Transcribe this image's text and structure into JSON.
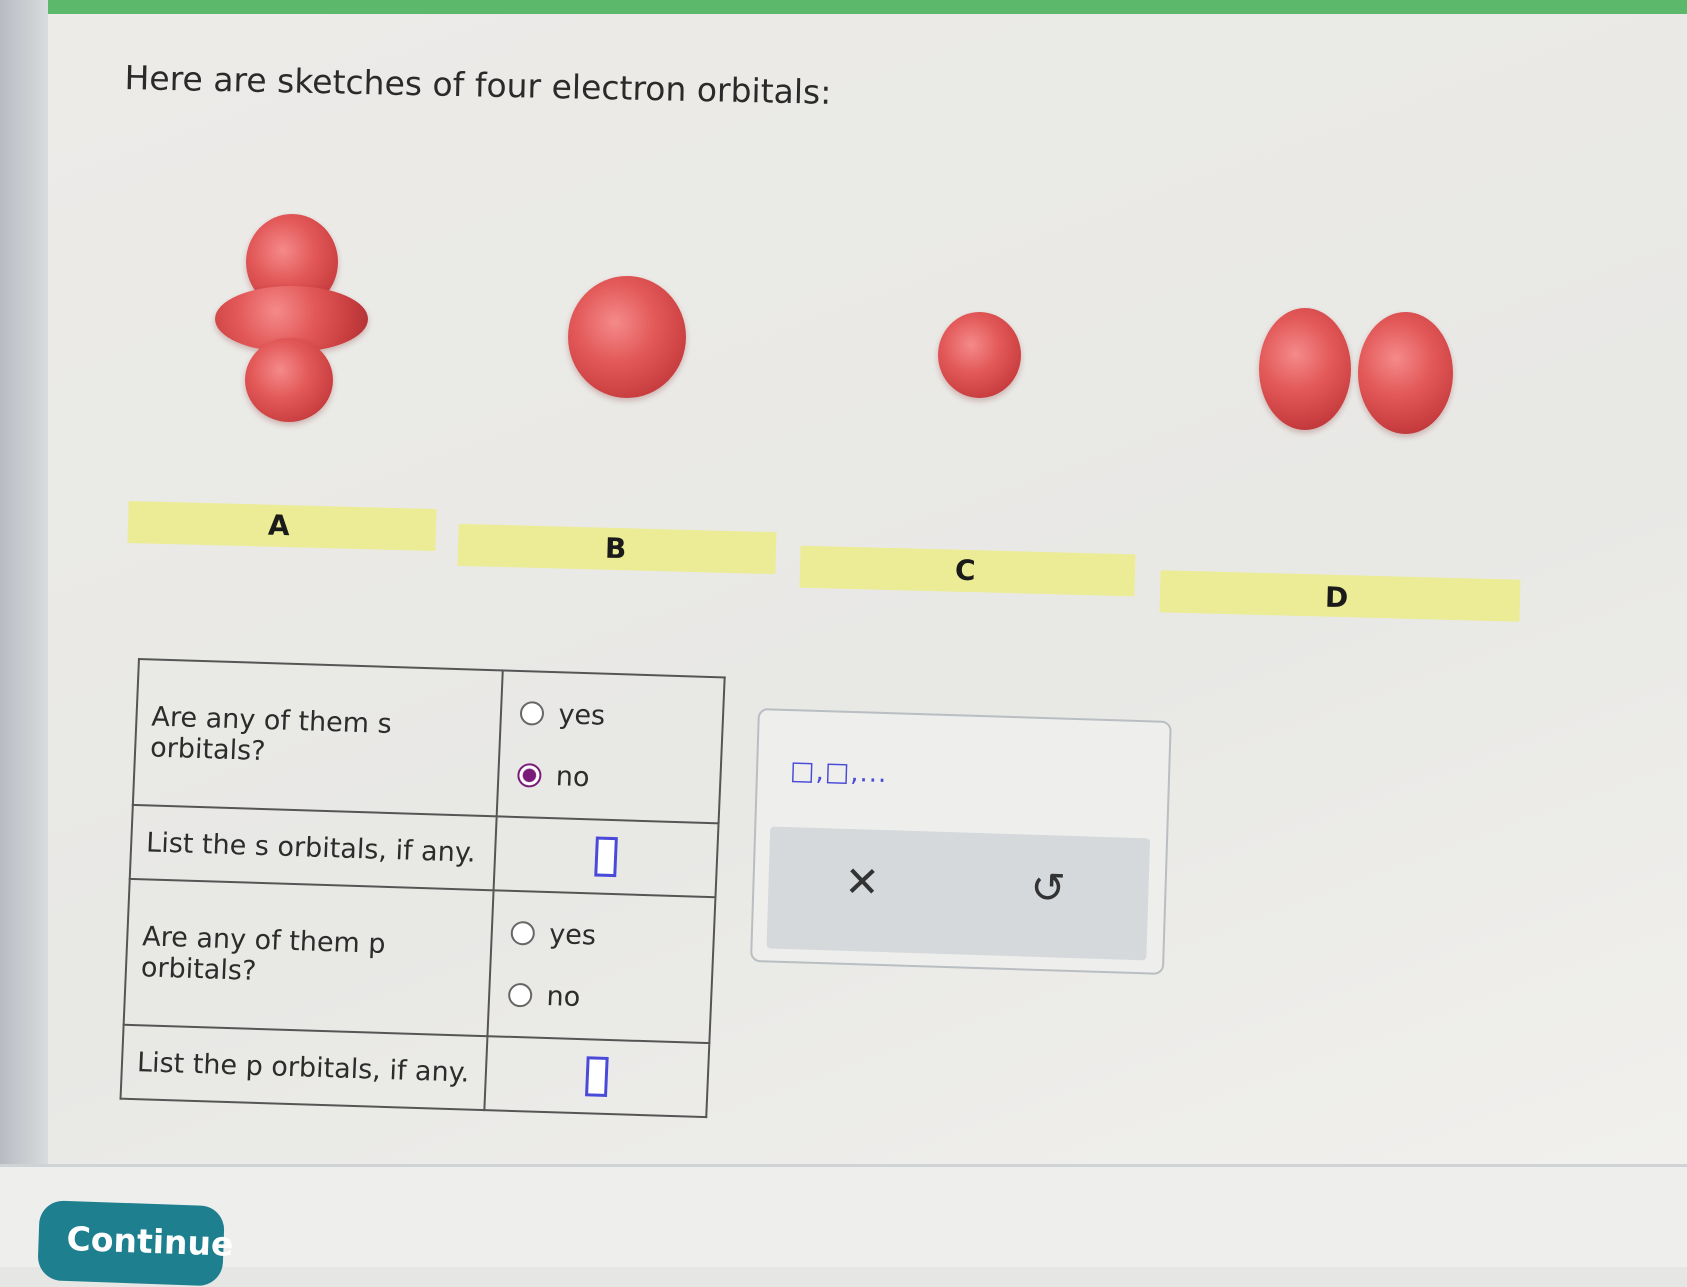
{
  "question": "Here are sketches of four electron orbitals:",
  "orbitals": [
    {
      "label": "A",
      "shape": "dz2"
    },
    {
      "label": "B",
      "shape": "s-large"
    },
    {
      "label": "C",
      "shape": "s-small"
    },
    {
      "label": "D",
      "shape": "p"
    }
  ],
  "table": {
    "rows": [
      {
        "question": "Are any of them s orbitals?",
        "options": [
          "yes",
          "no"
        ],
        "selected": "no"
      },
      {
        "question": "List the s orbitals, if any."
      },
      {
        "question": "Are any of them p orbitals?",
        "options": [
          "yes",
          "no"
        ],
        "selected": null
      },
      {
        "question": "List the p orbitals, if any."
      }
    ]
  },
  "tool": {
    "format_hint": "□,□,...",
    "clear_icon": "x-icon",
    "undo_icon": "undo-icon",
    "clear_symbol": "✕",
    "undo_symbol": "↺"
  },
  "continue_label": "Continue",
  "colors": {
    "accent": "#1e7f8f",
    "label_bg": "#ecec96",
    "orbital": "#e25757",
    "input_border": "#4a4ad8",
    "selected_radio": "#7a1c7a",
    "top_bar": "#5cb86a"
  }
}
